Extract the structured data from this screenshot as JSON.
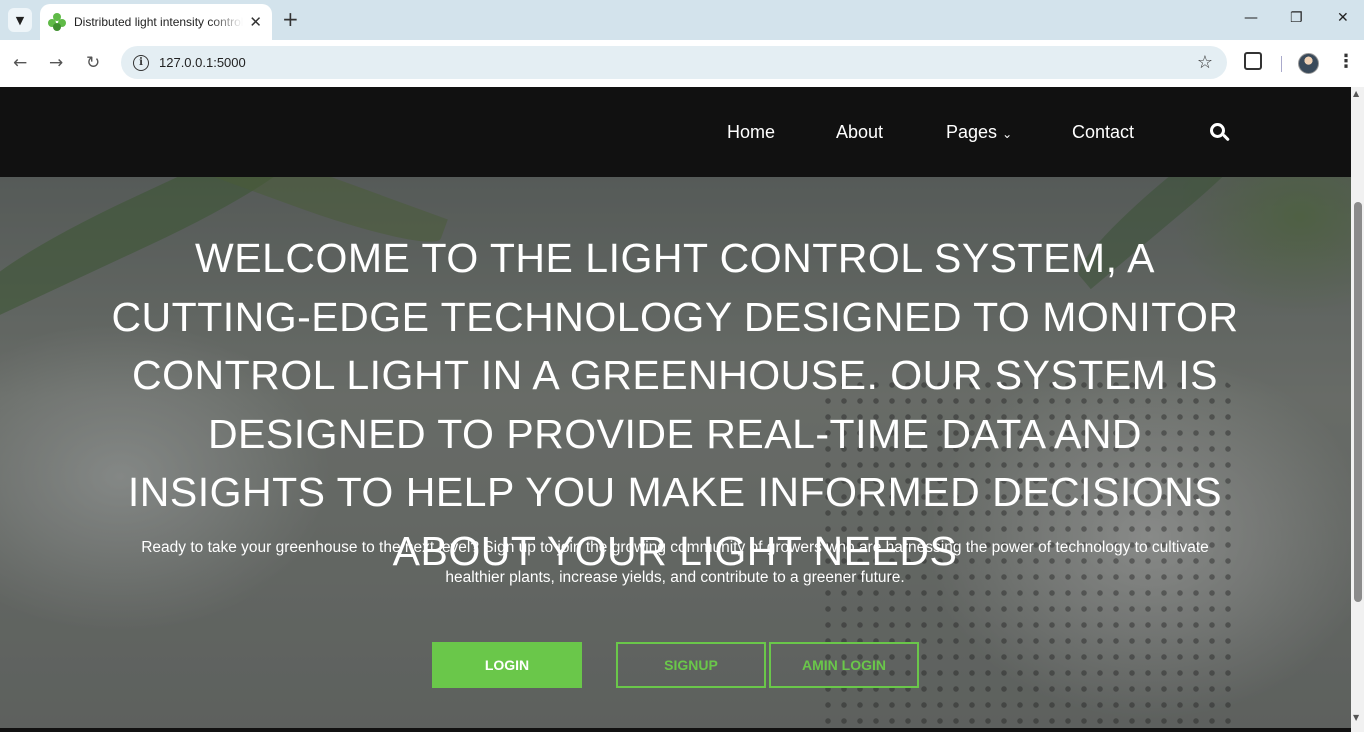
{
  "browser": {
    "tab_title": "Distributed light intensity control",
    "url": "127.0.0.1:5000",
    "new_tab": "+",
    "close": "✕",
    "minimize": "—",
    "restore": "❐",
    "window_close": "✕"
  },
  "nav": {
    "home": "Home",
    "about": "About",
    "pages": "Pages",
    "contact": "Contact"
  },
  "hero": {
    "title": "Welcome to the Light Control System, a cutting-edge technology designed to monitor control light in a greenhouse. Our system is designed to provide real-time data and insights to help you make informed decisions about your light needs",
    "subtitle": "Ready to take your greenhouse to the next level? Sign up to join the growing community of growers who are harnessing the power of technology to cultivate healthier plants, increase yields, and contribute to a greener future.",
    "login_label": "LOGIN",
    "signup_label": "SIGNUP",
    "admin_login_label": "AMIN LOGIN"
  },
  "colors": {
    "accent": "#6ac74a",
    "nav_bg": "#111111"
  },
  "icons": [
    "tab-search-icon",
    "favicon-icon",
    "back-icon",
    "forward-icon",
    "reload-icon",
    "info-icon",
    "star-icon",
    "extensions-icon",
    "profile-avatar",
    "menu-icon",
    "chevron-down-icon",
    "search-icon"
  ]
}
